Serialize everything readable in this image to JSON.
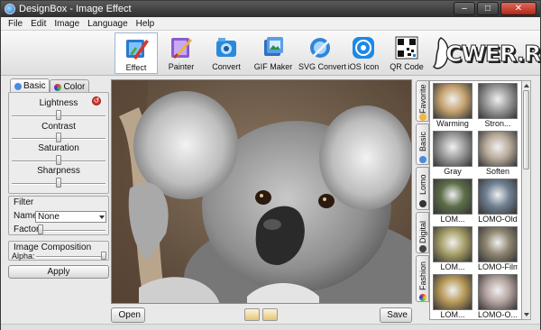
{
  "window": {
    "title": "DesignBox - Image Effect",
    "controls": {
      "minimize": "–",
      "maximize": "□",
      "close": "✕"
    }
  },
  "menu": [
    "File",
    "Edit",
    "Image",
    "Language",
    "Help"
  ],
  "toolbar": {
    "tools": [
      {
        "label": "Effect",
        "icon": "effect-icon",
        "active": true
      },
      {
        "label": "Painter",
        "icon": "painter-icon",
        "active": false
      },
      {
        "label": "Convert",
        "icon": "convert-icon",
        "active": false
      },
      {
        "label": "GIF Maker",
        "icon": "gif-maker-icon",
        "active": false
      },
      {
        "label": "SVG Convert",
        "icon": "svg-convert-icon",
        "active": false
      },
      {
        "label": "iOS Icon",
        "icon": "ios-icon-icon",
        "active": false
      },
      {
        "label": "QR Code",
        "icon": "qr-code-icon",
        "active": false
      }
    ],
    "watermark_text": "CWER.RU"
  },
  "left_panel": {
    "tabs": [
      {
        "label": "Basic",
        "active": true
      },
      {
        "label": "Color",
        "active": false
      }
    ],
    "sliders": [
      {
        "label": "Lightness",
        "value": 0.5
      },
      {
        "label": "Contrast",
        "value": 0.5
      },
      {
        "label": "Saturation",
        "value": 0.5
      },
      {
        "label": "Sharpness",
        "value": 0.5
      }
    ],
    "filter": {
      "title": "Filter",
      "name_label": "Name:",
      "name_value": "None",
      "factor_label": "Factor:",
      "factor_value": 0.0
    },
    "composition": {
      "title": "Image Composition",
      "alpha_label": "Alpha:",
      "alpha_value": 1.0
    },
    "apply_label": "Apply"
  },
  "bottom_bar": {
    "open_label": "Open",
    "save_label": "Save"
  },
  "effects_panel": {
    "categories": [
      "Favorite",
      "Basic",
      "Lomo",
      "Digital",
      "Fashion"
    ],
    "thumbnails": [
      {
        "caption": "Warming",
        "tint": "#c7a472"
      },
      {
        "caption": "Stron...",
        "tint": "#9a9a9a"
      },
      {
        "caption": "Gray",
        "tint": "#9c9c9c"
      },
      {
        "caption": "Soften",
        "tint": "#b7aa9a"
      },
      {
        "caption": "LOM...",
        "tint": "#5d6e4a"
      },
      {
        "caption": "LOMO-Old",
        "tint": "#6f8092"
      },
      {
        "caption": "LOM...",
        "tint": "#a8a06a"
      },
      {
        "caption": "LOMO-Film",
        "tint": "#8e8570"
      },
      {
        "caption": "LOM...",
        "tint": "#b89a5a"
      },
      {
        "caption": "LOMO-O...",
        "tint": "#b5a4a0"
      }
    ]
  },
  "colors": {
    "titlebar": "#3c3c3c",
    "panel_bg": "#e9e9e9",
    "accent": "#1d70c8"
  }
}
